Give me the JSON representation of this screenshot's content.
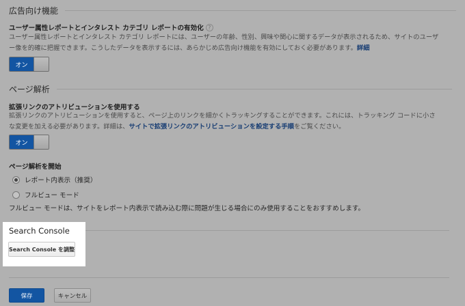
{
  "advertising": {
    "heading": "広告向け機能",
    "title": "ユーザー属性レポートとインタレスト カテゴリ レポートの有効化",
    "help_icon": "?",
    "desc_line1": "ユーザー属性レポートとインタレスト カテゴリ レポートには、ユーザーの年齢、性別、興味や関心に関するデータが表示されるため、サイトのユーザ",
    "desc_line2": "ー像を的確に把握できます。こうしたデータを表示するには、あらかじめ広告向け機能を有効にしておく必要があります。",
    "desc_link": "詳細",
    "toggle_label": "オン"
  },
  "page_analytics": {
    "heading": "ページ解析",
    "title": "拡張リンクのアトリビューションを使用する",
    "desc_line1": "拡張リンクのアトリビューションを使用すると、ページ上のリンクを細かくトラッキングすることができます。これには、トラッキング コードに小さ",
    "desc_line2_pre": "な変更を加える必要があります。詳細は、",
    "desc_link": "サイトで拡張リンクのアトリビューションを設定する手順",
    "desc_line2_post": "をご覧ください。",
    "toggle_label": "オン",
    "start_title": "ページ解析を開始",
    "options": [
      {
        "label": "レポート内表示（推奨）",
        "selected": true
      },
      {
        "label": "フルビュー モード",
        "selected": false
      }
    ],
    "note": "フルビュー モードは、サイトをレポート内表示で読み込む際に問題が生じる場合にのみ使用することをおすすめします。"
  },
  "search_console": {
    "heading": "Search Console",
    "button": "Search Console を調整"
  },
  "actions": {
    "save": "保存",
    "cancel": "キャンセル"
  },
  "colors": {
    "accent": "#1355a2",
    "link": "#1a3f74",
    "overlay_bg": "#b1b1b1"
  }
}
